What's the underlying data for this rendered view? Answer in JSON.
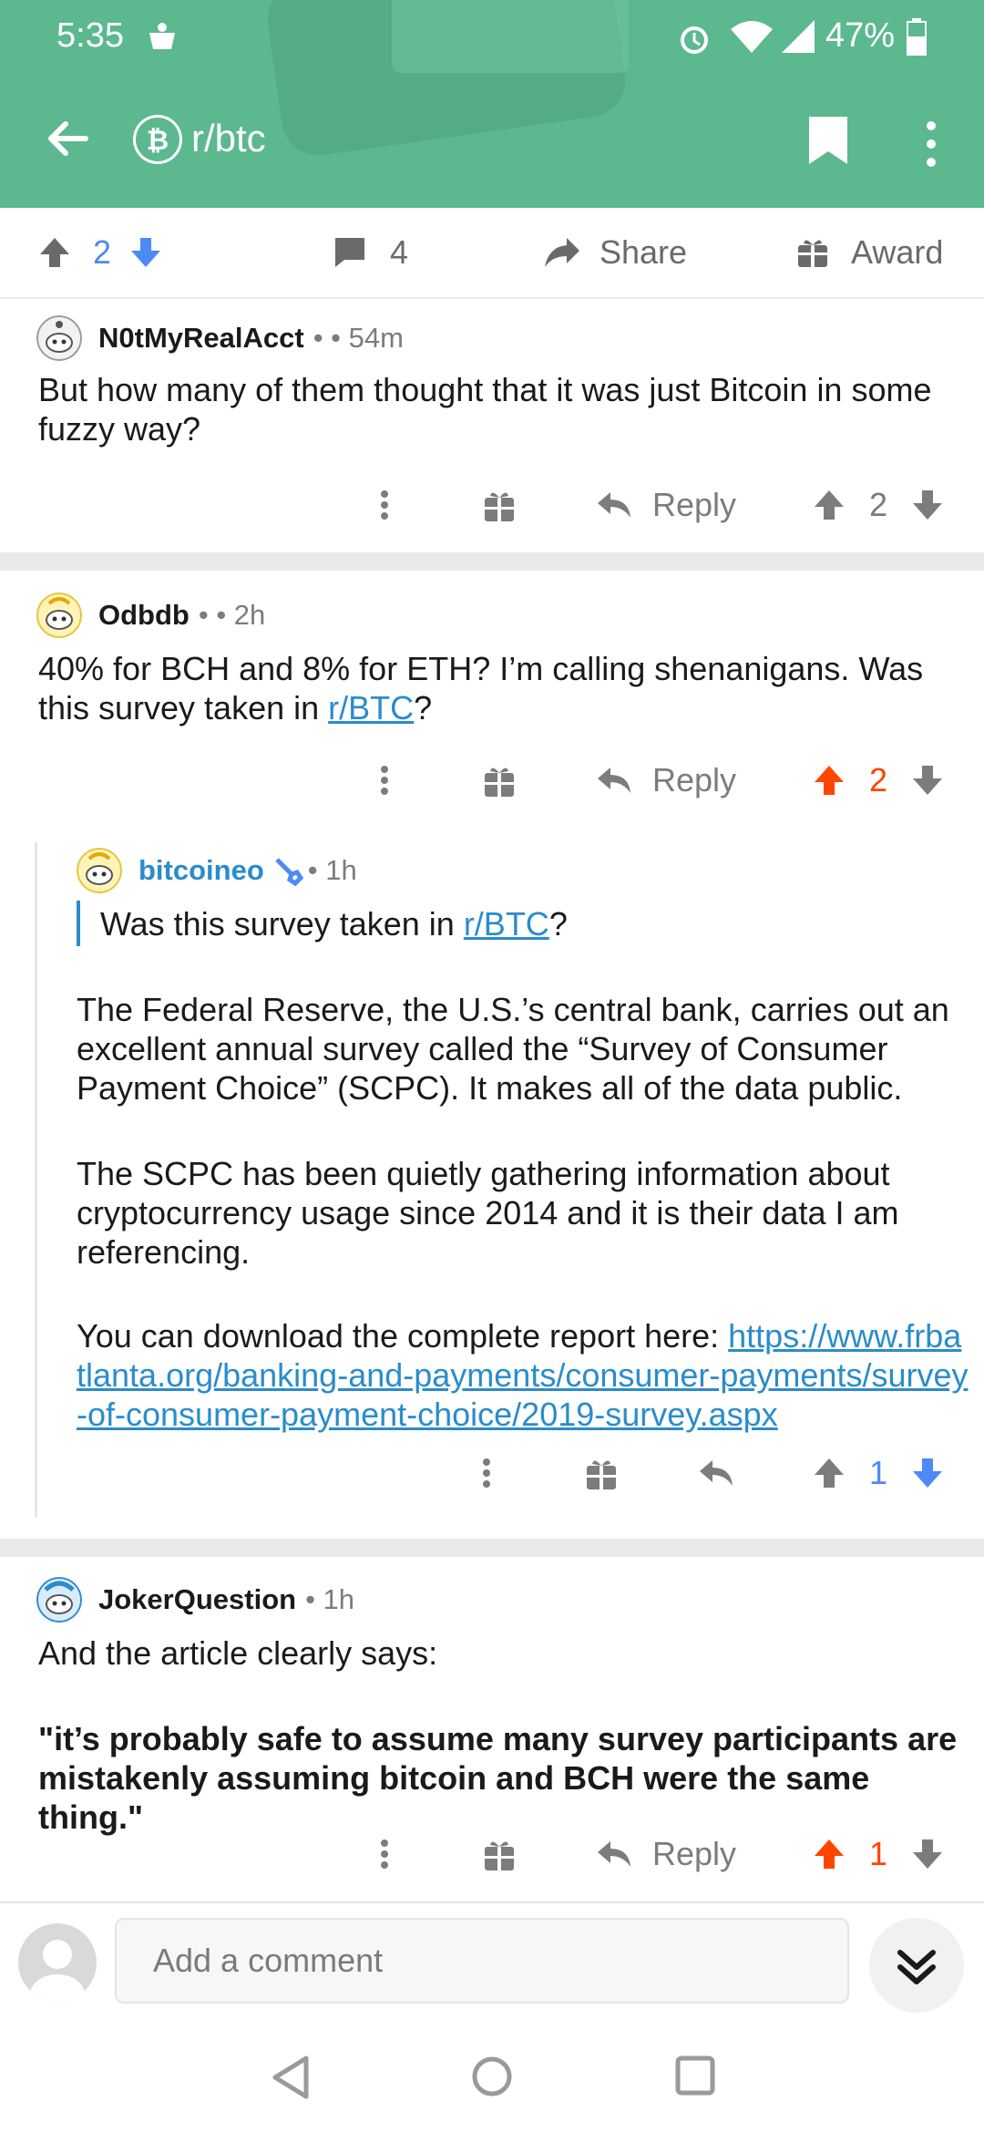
{
  "statusbar": {
    "time": "5:35",
    "battery": "47%"
  },
  "header": {
    "subreddit": "r/btc"
  },
  "post_actions": {
    "upvotes": "2",
    "comments": "4",
    "share": "Share",
    "award": "Award"
  },
  "comments": [
    {
      "user": "N0tMyRealAcct",
      "meta": "• • 54m",
      "body": "But how many of them thought that it was just Bitcoin in some fuzzy way?",
      "reply": "Reply",
      "votes": "2"
    },
    {
      "user": "Odbdb",
      "meta": "• • 2h",
      "body_prefix": "40% for BCH and 8% for ETH?  I’m calling shenanigans.  Was this survey taken in ",
      "body_link": "r/BTC",
      "body_suffix": "?",
      "reply": "Reply",
      "votes": "2"
    },
    {
      "user": "bitcoineo",
      "meta": "• 1h",
      "quote_prefix": "Was this survey taken in ",
      "quote_link": "r/BTC",
      "quote_suffix": "?",
      "para1": "The Federal Reserve, the U.S.’s central bank, carries out an excellent annual survey called the “Survey of Consumer Payment Choice” (SCPC). It makes all of the data public.",
      "para2": "The SCPC has been quietly gathering information about cryptocurrency usage since 2014 and it is their data I am referencing.",
      "para3_prefix": "You can download the complete report here: ",
      "para3_link": "https://www.frbatlanta.org/banking-and-payments/consumer-payments/survey-of-consumer-payment-choice/2019-survey.aspx",
      "votes": "1"
    },
    {
      "user": "JokerQuestion",
      "meta": "• 1h",
      "line1": "And the article clearly says:",
      "line2": "\"it’s probably safe to assume many survey participants are mistakenly assuming bitcoin and BCH were the same thing.\"",
      "reply": "Reply",
      "votes": "1"
    }
  ],
  "composer": {
    "placeholder": "Add a comment"
  },
  "colors": {
    "header": "#5cb88f",
    "upvote_active": "#ff4500",
    "downvote_active": "#4c8bf5",
    "link": "#2a8ccb"
  }
}
